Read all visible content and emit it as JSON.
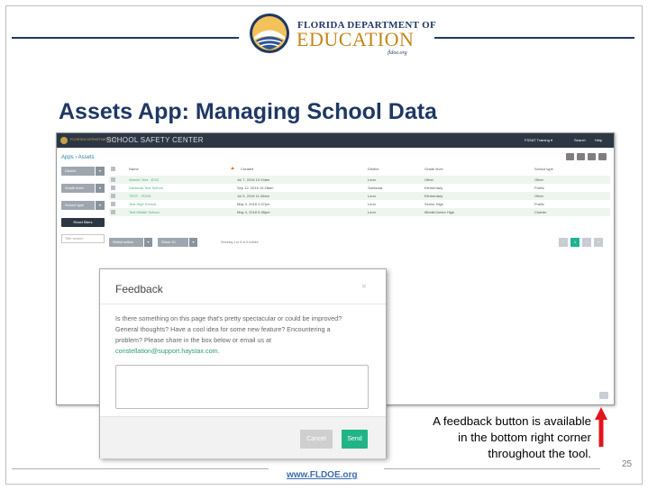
{
  "logo": {
    "line1": "FLORIDA DEPARTMENT OF",
    "line2": "EDUCATION",
    "line3": "fldoe.org"
  },
  "slide": {
    "title": "Assets App: Managing School Data",
    "page_number": "25",
    "footer_url": "www.FLDOE.org"
  },
  "app": {
    "name": "SCHOOL SAFETY CENTER",
    "menu": [
      "FSSAT Training ▾",
      "Search",
      "Help"
    ],
    "breadcrumb": "Apps › Assets",
    "filters": [
      {
        "label": "District"
      },
      {
        "label": "Grade level"
      },
      {
        "label": "School type"
      }
    ],
    "reset_label": "Reset filters",
    "title_search_placeholder": "Title search",
    "columns": [
      "Name",
      "Created",
      "District",
      "Grade level",
      "School type"
    ],
    "rows": [
      {
        "name": "Abertin Test - EOS",
        "created": "Jul 7, 2016 10:19am",
        "district": "Leon",
        "grade": "Other",
        "type": "Other"
      },
      {
        "name": "Sarasota Test School",
        "created": "Sep 12, 2016 10:28am",
        "district": "Sarasota",
        "grade": "Elementary",
        "type": "Public"
      },
      {
        "name": "TEST - FDOE",
        "created": "Jul 5, 2016 11:49am",
        "district": "Leon",
        "grade": "Elementary",
        "type": "Other"
      },
      {
        "name": "Test High School",
        "created": "May 3, 2018 2:47pm",
        "district": "Leon",
        "grade": "Senior High",
        "type": "Public"
      },
      {
        "name": "Test Middle School",
        "created": "May 4, 2018 5:38pm",
        "district": "Leon",
        "grade": "Middle/Junior High",
        "type": "Charter"
      }
    ],
    "bulk_actions": [
      "Select action",
      "Show 10"
    ],
    "showing": "Showing 1 to 5 of 5 entries",
    "pagination": [
      "‹",
      "1",
      "›",
      "»"
    ]
  },
  "modal": {
    "title": "Feedback",
    "close": "×",
    "body_lines": [
      "Is there something on this page that's pretty spectacular or could be improved?",
      "General thoughts? Have a cool idea for some new feature? Encountering a",
      "problem? Please share in the box below or email us at"
    ],
    "email": "constellation@support.haystax.com.",
    "textarea_value": "",
    "cancel_label": "Cancel",
    "send_label": "Send"
  },
  "callout": {
    "lines": [
      "A feedback button is available",
      "in the bottom right corner",
      "throughout the tool."
    ]
  },
  "colors": {
    "navy": "#1f3864",
    "gold": "#c5861b",
    "app_bar": "#2d3744",
    "send_green": "#21b486",
    "arrow_red": "#e3141b"
  }
}
